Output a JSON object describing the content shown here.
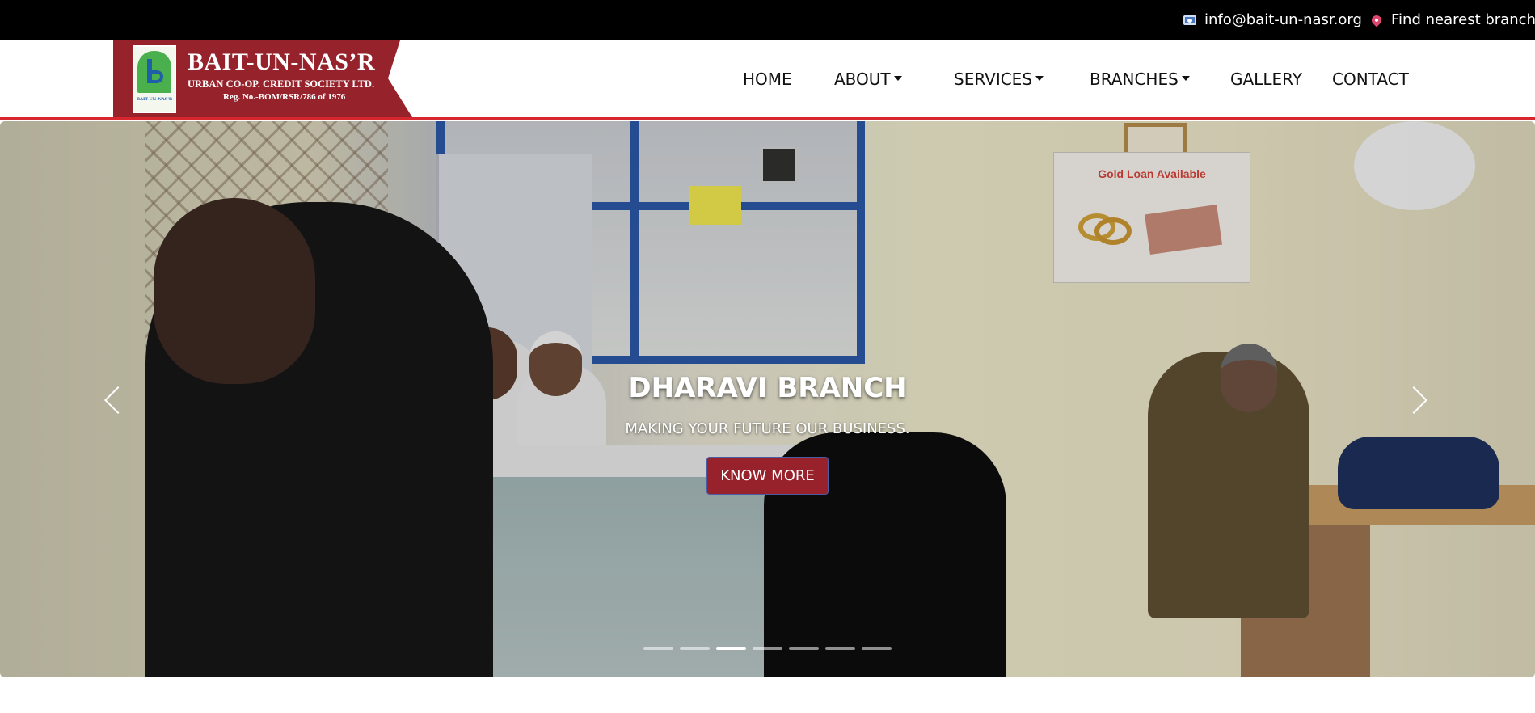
{
  "topbar": {
    "email": "info@bait-un-nasr.org",
    "branch_link": "Find nearest branch",
    "email_icon": "mail-icon",
    "branch_icon": "location-pin-icon"
  },
  "logo": {
    "title": "BAIT-UN-NAS’R",
    "subtitle": "URBAN CO-OP. CREDIT SOCIETY LTD.",
    "reg": "Reg. No.-BOM/RSR/786 of 1976",
    "emblem_text": "BAIT-UN-NAS'R",
    "brand_color": "#96232c"
  },
  "nav": [
    {
      "label": "HOME",
      "dropdown": false
    },
    {
      "label": "ABOUT",
      "dropdown": true
    },
    {
      "label": "SERVICES",
      "dropdown": true
    },
    {
      "label": "BRANCHES",
      "dropdown": true
    },
    {
      "label": "GALLERY",
      "dropdown": false
    },
    {
      "label": "CONTACT",
      "dropdown": false
    }
  ],
  "hero": {
    "title": "DHARAVI BRANCH",
    "subtitle": "MAKING YOUR FUTURE OUR BUSINESS.",
    "button": "KNOW MORE",
    "poster_title": "Gold Loan Available",
    "slide_count": 7,
    "active_slide": 3,
    "prev_icon": "chevron-left-icon",
    "next_icon": "chevron-right-icon"
  },
  "colors": {
    "topbar": "#000000",
    "accent_line": "#d7262e",
    "button": "#98222b"
  }
}
